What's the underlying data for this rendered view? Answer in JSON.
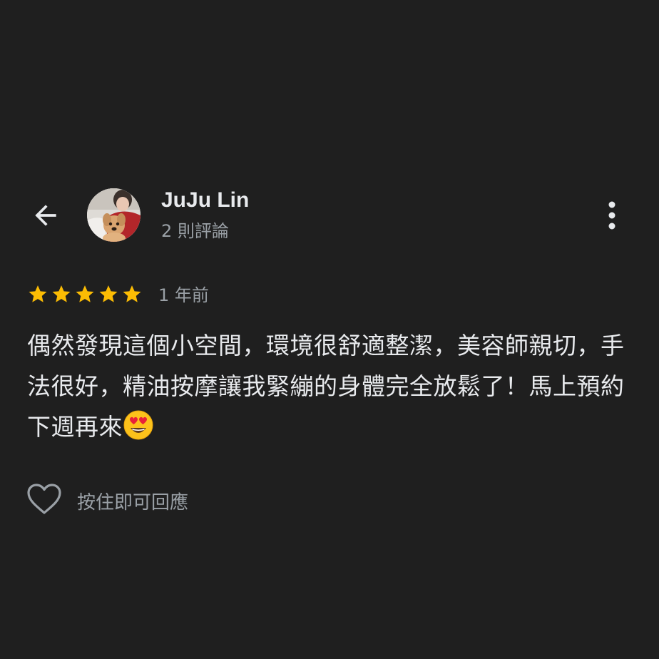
{
  "header": {
    "back_icon": "arrow-left-icon",
    "avatar_icon": "user-photo-with-dog",
    "user_name": "JuJu Lin",
    "review_count": "2 則評論",
    "more_icon": "more-vertical-icon"
  },
  "rating": {
    "stars": 5,
    "max_stars": 5,
    "star_color": "#fbbc04",
    "time_ago": "1 年前"
  },
  "review": {
    "text": "偶然發現這個小空間，環境很舒適整潔，美容師親切，手法很好，精油按摩讓我緊繃的身體完全放鬆了！馬上預約下週再來",
    "emoji": "smiling-face-with-heart-eyes"
  },
  "actions": {
    "like_icon": "heart-outline-icon",
    "reply_hint": "按住即可回應"
  },
  "colors": {
    "background": "#1f1f1f",
    "primary_text": "#e8eaed",
    "secondary_text": "#9aa0a6"
  }
}
